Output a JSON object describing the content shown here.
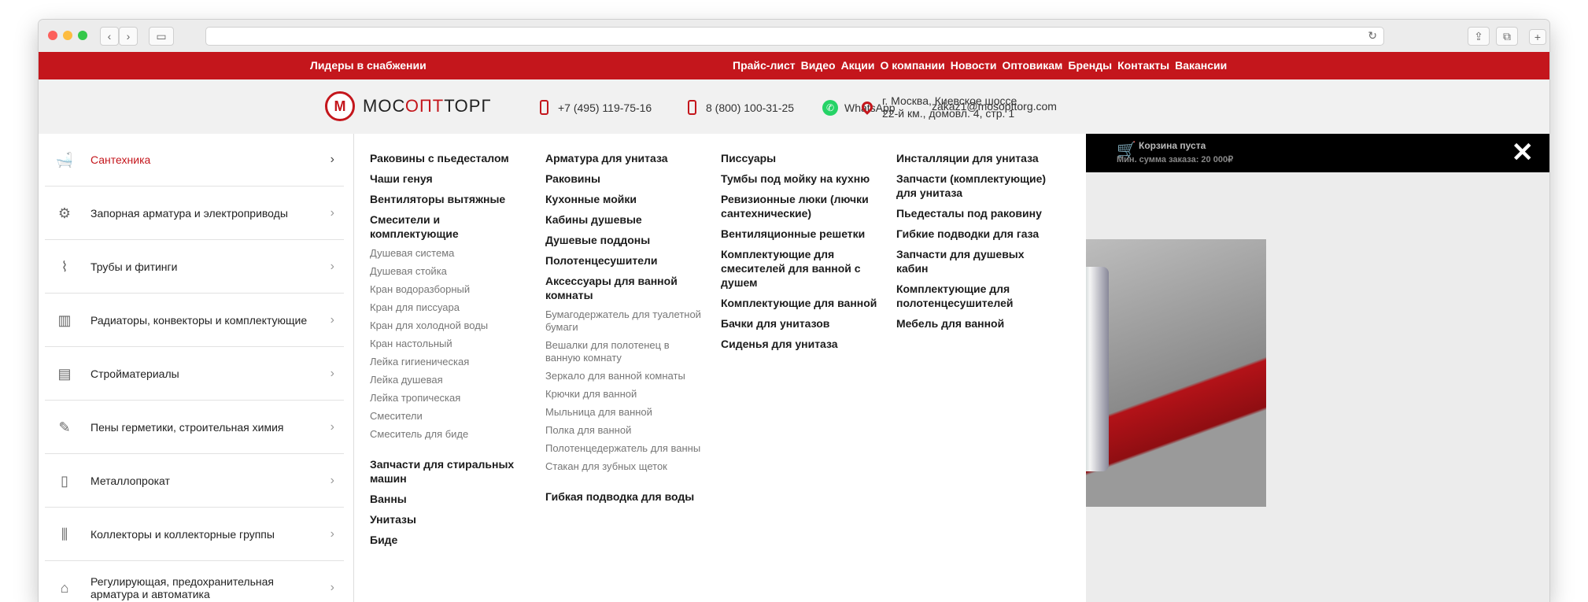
{
  "topbar": {
    "slogan": "Лидеры в снабжении",
    "nav": [
      "Прайс-лист",
      "Видео",
      "Акции",
      "О компании",
      "Новости",
      "Оптовикам",
      "Бренды",
      "Контакты",
      "Вакансии"
    ]
  },
  "header": {
    "logo_part1": "МОС",
    "logo_part2": "ОПТ",
    "logo_part3": "ТОРГ",
    "phone1": "+7 (495) 119-75-16",
    "phone2": "8 (800) 100-31-25",
    "whatsapp": "WhatsApp",
    "email": "zakaz1@mosopttorg.com",
    "address_line1": "г. Москва, Киевское шоссе",
    "address_line2": "22-й км., домовл. 4, стр. 1"
  },
  "cart": {
    "title": "Корзина пуста",
    "min_order": "Мин. сумма заказа: 20 000₽"
  },
  "close_symbol": "✕",
  "sidebar": {
    "items": [
      {
        "label": "Сантехника",
        "icon": "bathtub-icon",
        "active": true
      },
      {
        "label": "Запорная арматура и электроприводы",
        "icon": "valve-icon"
      },
      {
        "label": "Трубы и фитинги",
        "icon": "pipe-icon"
      },
      {
        "label": "Радиаторы, конвекторы и комплектующие",
        "icon": "radiator-icon"
      },
      {
        "label": "Стройматериалы",
        "icon": "bricks-icon"
      },
      {
        "label": "Пены герметики, строительная химия",
        "icon": "sealant-gun-icon"
      },
      {
        "label": "Металлопрокат",
        "icon": "metal-roll-icon"
      },
      {
        "label": "Коллекторы и коллекторные группы",
        "icon": "manifold-icon"
      },
      {
        "label": "Регулирующая, предохранительная арматура и автоматика",
        "icon": "regulator-icon"
      }
    ]
  },
  "menu": {
    "col1": {
      "headings_top": [
        "Раковины с пьедесталом",
        "Чаши генуя",
        "Вентиляторы вытяжные",
        "Смесители и комплектующие"
      ],
      "subs": [
        "Душевая система",
        "Душевая стойка",
        "Кран водоразборный",
        "Кран для писсуара",
        "Кран для холодной воды",
        "Кран настольный",
        "Лейка гигиеническая",
        "Лейка душевая",
        "Лейка тропическая",
        "Смесители",
        "Смеситель для биде"
      ],
      "headings_bottom": [
        "Запчасти для стиральных машин",
        "Ванны",
        "Унитазы",
        "Биде"
      ]
    },
    "col2": {
      "headings_top": [
        "Арматура для унитаза",
        "Раковины",
        "Кухонные мойки",
        "Кабины душевые",
        "Душевые поддоны",
        "Полотенцесушители",
        "Аксессуары для ванной комнаты"
      ],
      "subs": [
        "Бумагодержатель для туалетной бумаги",
        "Вешалки для полотенец в ванную комнату",
        "Зеркало для ванной комнаты",
        "Крючки для ванной",
        "Мыльница для ванной",
        "Полка для ванной",
        "Полотенцедержатель для ванны",
        "Стакан для зубных щеток"
      ],
      "headings_bottom": [
        "Гибкая подводка для воды"
      ]
    },
    "col3": {
      "headings_top": [
        "Писсуары",
        "Тумбы под мойку на кухню",
        "Ревизионные люки (лючки сантехнические)",
        "Вентиляционные решетки",
        "Комплектующие для смесителей для ванной с душем",
        "Комплектующие для ванной",
        "Бачки для унитазов",
        "Сиденья для унитаза"
      ]
    },
    "col4": {
      "headings_top": [
        "Инсталляции для унитаза",
        "Запчасти (комплектующие) для унитаза",
        "Пьедесталы под раковину",
        "Гибкие подводки для газа",
        "Запчасти для душевых кабин",
        "Комплектующие для полотенцесушителей",
        "Мебель для ванной"
      ]
    }
  }
}
